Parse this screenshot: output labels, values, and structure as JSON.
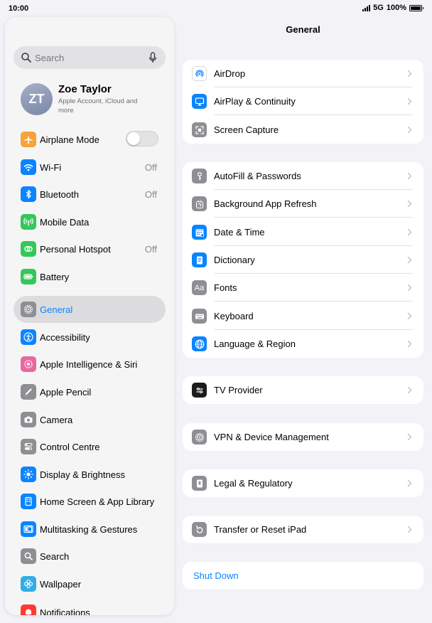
{
  "status_bar": {
    "time": "10:00",
    "network": "5G",
    "battery": "100%"
  },
  "search": {
    "placeholder": "Search"
  },
  "profile": {
    "initials": "ZT",
    "name": "Zoe Taylor",
    "subtitle": "Apple Account, iCloud and more"
  },
  "sidebar": {
    "items": [
      {
        "label": "Airplane Mode",
        "icon": "airplane-icon",
        "color": "#f7a23b",
        "toggle": "off"
      },
      {
        "label": "Wi-Fi",
        "icon": "wifi-icon",
        "color": "#0a84ff",
        "value": "Off"
      },
      {
        "label": "Bluetooth",
        "icon": "bluetooth-icon",
        "color": "#0a84ff",
        "value": "Off"
      },
      {
        "label": "Mobile Data",
        "icon": "antenna-icon",
        "color": "#34c759"
      },
      {
        "label": "Personal Hotspot",
        "icon": "hotspot-icon",
        "color": "#34c759",
        "value": "Off"
      },
      {
        "label": "Battery",
        "icon": "battery-icon",
        "color": "#34c759"
      },
      {
        "label": "General",
        "icon": "gear-icon",
        "color": "#8e8e93",
        "selected": true
      },
      {
        "label": "Accessibility",
        "icon": "accessibility-icon",
        "color": "#0a84ff"
      },
      {
        "label": "Apple Intelligence & Siri",
        "icon": "siri-icon",
        "color": "#e8689f"
      },
      {
        "label": "Apple Pencil",
        "icon": "pencil-icon",
        "color": "#8e8e93"
      },
      {
        "label": "Camera",
        "icon": "camera-icon",
        "color": "#8e8e93"
      },
      {
        "label": "Control Centre",
        "icon": "control-centre-icon",
        "color": "#8e8e93"
      },
      {
        "label": "Display & Brightness",
        "icon": "sun-icon",
        "color": "#0a84ff"
      },
      {
        "label": "Home Screen & App Library",
        "icon": "home-screen-icon",
        "color": "#0a84ff"
      },
      {
        "label": "Multitasking & Gestures",
        "icon": "multitasking-icon",
        "color": "#0a84ff"
      },
      {
        "label": "Search",
        "icon": "search-icon",
        "color": "#8e8e93"
      },
      {
        "label": "Wallpaper",
        "icon": "wallpaper-icon",
        "color": "#32ade6"
      },
      {
        "label": "Notifications",
        "icon": "bell-icon",
        "color": "#ff3b30"
      }
    ]
  },
  "main": {
    "title": "General",
    "groups": [
      [
        {
          "label": "AirDrop",
          "icon": "airdrop-icon",
          "color": "#ffffff"
        },
        {
          "label": "AirPlay & Continuity",
          "icon": "airplay-icon",
          "color": "#0a84ff"
        },
        {
          "label": "Screen Capture",
          "icon": "screen-capture-icon",
          "color": "#8e8e93"
        }
      ],
      [
        {
          "label": "AutoFill & Passwords",
          "icon": "key-icon",
          "color": "#8e8e93"
        },
        {
          "label": "Background App Refresh",
          "icon": "refresh-icon",
          "color": "#8e8e93"
        },
        {
          "label": "Date & Time",
          "icon": "calendar-icon",
          "color": "#0a84ff"
        },
        {
          "label": "Dictionary",
          "icon": "book-icon",
          "color": "#0a84ff"
        },
        {
          "label": "Fonts",
          "icon": "fonts-icon",
          "color": "#8e8e93"
        },
        {
          "label": "Keyboard",
          "icon": "keyboard-icon",
          "color": "#8e8e93"
        },
        {
          "label": "Language & Region",
          "icon": "globe-icon",
          "color": "#0a84ff"
        }
      ],
      [
        {
          "label": "TV Provider",
          "icon": "tv-provider-icon",
          "color": "#1c1c1e"
        }
      ],
      [
        {
          "label": "VPN & Device Management",
          "icon": "gear-icon",
          "color": "#8e8e93"
        }
      ],
      [
        {
          "label": "Legal & Regulatory",
          "icon": "legal-icon",
          "color": "#8e8e93"
        }
      ],
      [
        {
          "label": "Transfer or Reset iPad",
          "icon": "reset-icon",
          "color": "#8e8e93"
        }
      ]
    ],
    "shut_down": "Shut Down"
  }
}
